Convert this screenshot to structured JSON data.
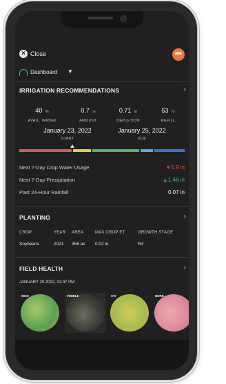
{
  "header": {
    "close_label": "Close",
    "avatar_initials": "RR"
  },
  "dashboard": {
    "label": "Dashboard"
  },
  "irrigation": {
    "title": "IRRIGATION RECOMMENDATIONS",
    "metrics": [
      {
        "value": "40",
        "unit": "%",
        "label": "AVAIL. WATER"
      },
      {
        "value": "0.7",
        "unit": "in",
        "label": "AMOUNT"
      },
      {
        "value": "0.71",
        "unit": "in",
        "label": "DEPLETION"
      },
      {
        "value": "53",
        "unit": "hr",
        "label": "REFILL"
      }
    ],
    "start": {
      "date": "January 23, 2022",
      "label": "START"
    },
    "due": {
      "date": "January 25, 2022",
      "label": "DUE"
    },
    "bar_colors": [
      "#e0574f",
      "#e9c94a",
      "#4fb86b",
      "#49b3d6",
      "#3a6fd8"
    ],
    "rows": [
      {
        "label": "Next 7-Day Crop Water Usage",
        "value": "0.9 in",
        "trend": "down",
        "color": "#e0574f"
      },
      {
        "label": "Next 7-Day Precipitation",
        "value": "1.46 in",
        "trend": "up",
        "color": "#4fb86b"
      },
      {
        "label": "Past 24-Hour Rainfall",
        "value": "0.07 in",
        "trend": "none",
        "color": "#f0f0f0"
      }
    ]
  },
  "planting": {
    "title": "PLANTING",
    "headers": [
      "CROP",
      "YEAR",
      "AREA",
      "MAX CROP ET",
      "GROWTH STAGE"
    ],
    "row": [
      "Soybeans",
      "2021",
      "356 ac",
      "0.02 in",
      "R4"
    ]
  },
  "field_health": {
    "title": "FIELD HEALTH",
    "date": "JANUARY 20 2022, 02:47 PM",
    "images": [
      {
        "label": "NDVI",
        "color": "#7fb35a"
      },
      {
        "label": "VISIBLE",
        "color": "#4a4a44"
      },
      {
        "label": "CVI",
        "color": "#b9c24e"
      },
      {
        "label": "NDRE",
        "color": "#d98a9a"
      }
    ]
  }
}
